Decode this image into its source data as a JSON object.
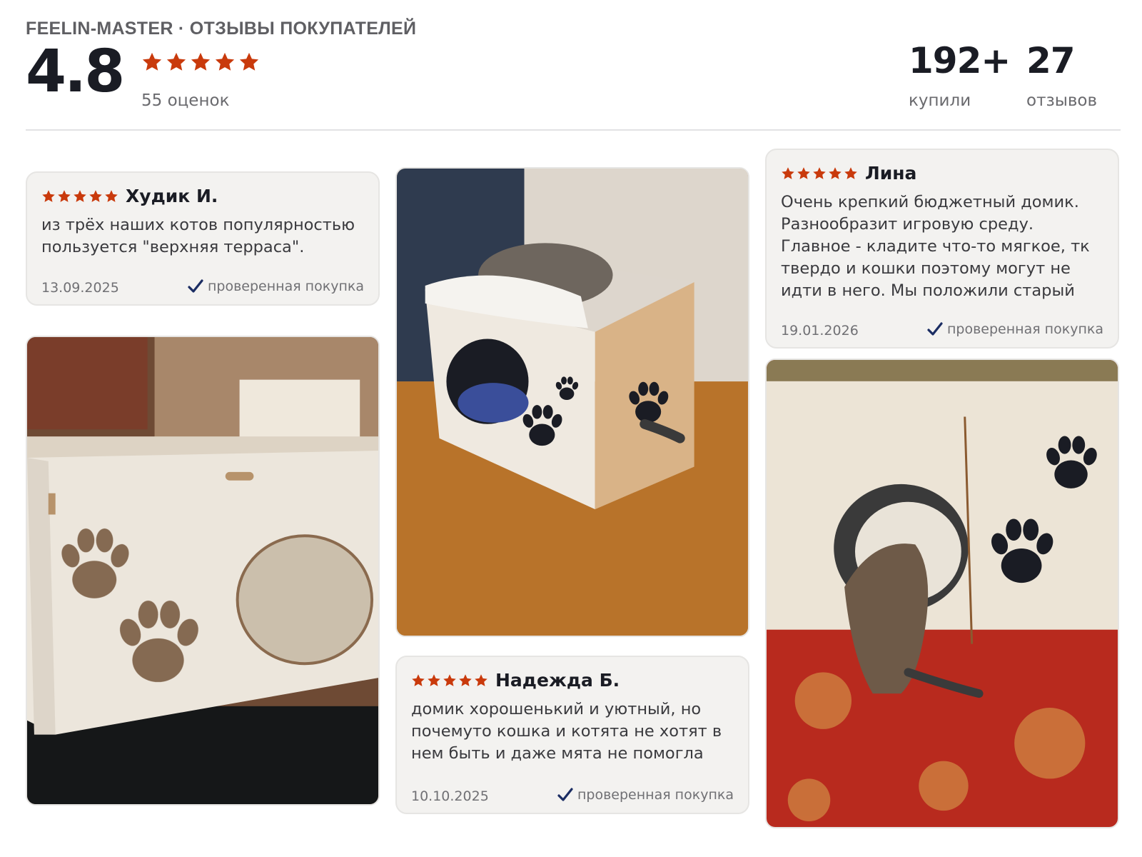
{
  "header": {
    "store_title": "FEELIN-MASTER · ОТЗЫВЫ ПОКУПАТЕЛЕЙ",
    "rating": "4.8",
    "ratings_count": "55 оценок",
    "stars": 5,
    "bought_value": "192+",
    "bought_label": "купили",
    "reviews_value": "27",
    "reviews_label": "отзывов"
  },
  "colors": {
    "star": "#c93a0c",
    "check": "#1b2d63"
  },
  "reviews": [
    {
      "author": "Худик И.",
      "stars": 5,
      "text": "из трёх наших котов популярностью пользуется \"верхняя терраса\".",
      "date": "13.09.2025",
      "verified": "проверенная покупка"
    },
    {
      "author": "Лина",
      "stars": 5,
      "text": "Очень крепкий бюджетный домик. Разнообразит игровую среду. Главное - кладите что-то мягкое, тк твердо и кошки поэтому могут не идти в него. Мы положили старый компьютерный...",
      "date": "19.01.2026",
      "verified": "проверенная покупка"
    },
    {
      "author": "Надежда Б.",
      "stars": 5,
      "text": "домик хорошенький и уютный, но почемуто кошка и котята не хотят в нем быть и даже мята не помогла",
      "date": "10.10.2025",
      "verified": "проверенная покупка"
    }
  ],
  "photos": [
    {
      "name": "photo-cat-house-paws-light",
      "icon": "cat-house-photo"
    },
    {
      "name": "photo-cat-sleeping-on-roof",
      "icon": "cat-house-photo"
    },
    {
      "name": "photo-kitten-entering-house",
      "icon": "cat-house-photo"
    }
  ]
}
